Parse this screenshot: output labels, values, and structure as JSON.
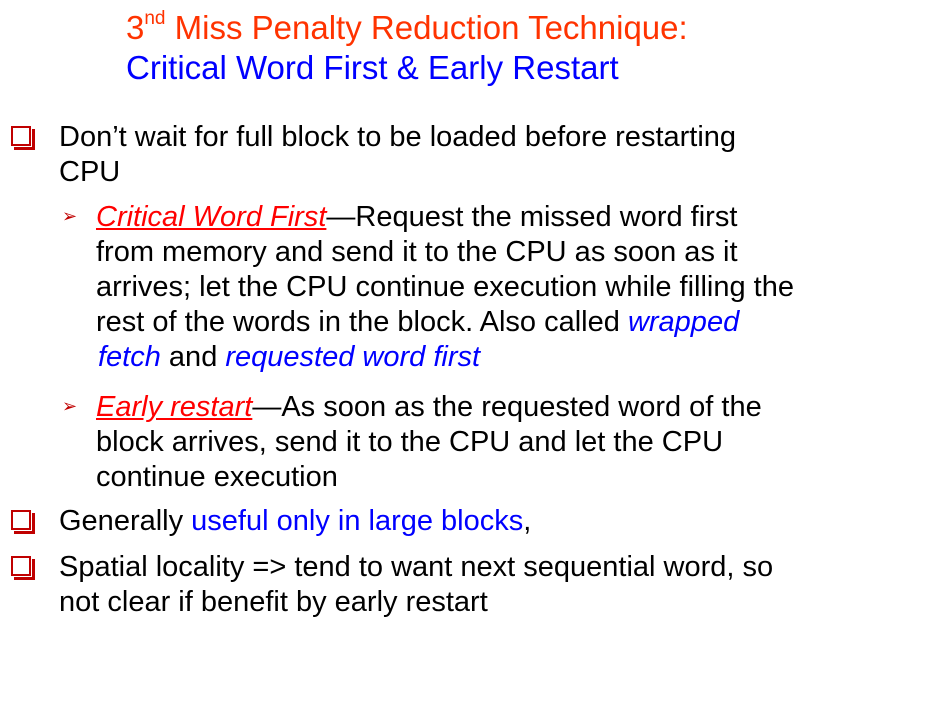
{
  "title": {
    "line1_prefix": "3",
    "line1_sup": "nd",
    "line1_rest": " Miss Penalty Reduction Technique:",
    "line2": "Critical Word First  &  Early Restart"
  },
  "bullets": {
    "b1": {
      "text": "Don’t wait for full block to be loaded before restarting",
      "text2": "CPU"
    },
    "s1": {
      "term": "Critical Word First",
      "line1": "—Request the missed word first",
      "line2": "from memory and send it to the CPU as soon as it",
      "line3": "arrives; let the CPU continue execution while filling the",
      "line4a": "rest of the words in the block. Also called ",
      "alias1a": "wrapped",
      "alias1b": "fetch",
      "and": " and ",
      "alias2": "requested word  first"
    },
    "s2": {
      "term": "Early restart",
      "line1": "—As soon as the requested word of the",
      "line2": "block arrives, send it to the CPU and let the CPU",
      "line3": "continue execution"
    },
    "b2": {
      "prefix": "Generally ",
      "highlight": "useful only in large blocks",
      "suffix": ","
    },
    "b3": {
      "line1": "Spatial locality => tend to want next sequential word, so",
      "line2": "not clear if benefit by early restart"
    }
  },
  "colors": {
    "title_red": "#ff3300",
    "title_blue": "#0000ff",
    "bullet_box": "#c00000",
    "term_red": "#ff0000",
    "alias_blue": "#0000ff"
  },
  "icons": {
    "level1": "hollow-square-bullet-icon",
    "level2": "arrowhead-bullet-icon"
  }
}
